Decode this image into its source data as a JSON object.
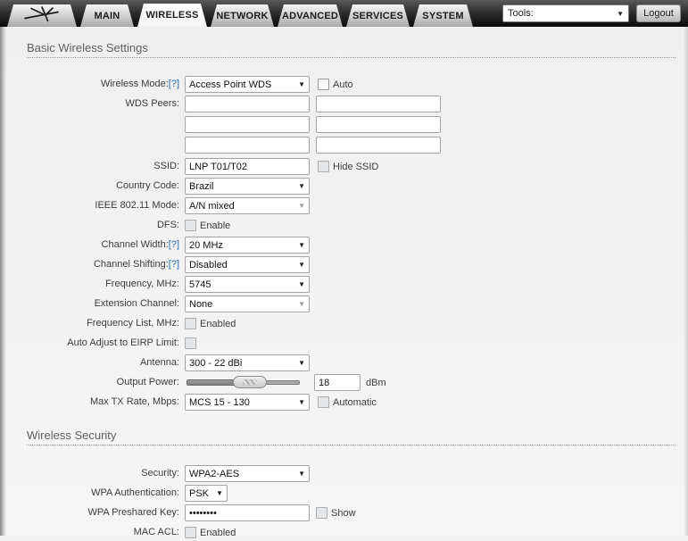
{
  "topbar": {
    "tabs": [
      "MAIN",
      "WIRELESS",
      "NETWORK",
      "ADVANCED",
      "SERVICES",
      "SYSTEM"
    ],
    "active_tab": "WIRELESS",
    "tools_label": "Tools:",
    "logout_label": "Logout",
    "select_arrow": "▼"
  },
  "basic_wireless": {
    "title": "Basic Wireless Settings",
    "wireless_mode": {
      "label": "Wireless Mode:",
      "help": "[?]",
      "value": "Access Point WDS",
      "auto_checkbox_label": "Auto"
    },
    "wds_peers": {
      "label": "WDS Peers:",
      "values": [
        "",
        "",
        "",
        "",
        "",
        ""
      ]
    },
    "ssid": {
      "label": "SSID:",
      "value": "LNP T01/T02",
      "hide_checkbox_label": "Hide SSID"
    },
    "country_code": {
      "label": "Country Code:",
      "value": "Brazil"
    },
    "ieee_mode": {
      "label": "IEEE 802.11 Mode:",
      "value": "A/N mixed"
    },
    "dfs": {
      "label": "DFS:",
      "checkbox_label": "Enable"
    },
    "channel_width": {
      "label": "Channel Width:",
      "help": "[?]",
      "value": "20 MHz"
    },
    "channel_shifting": {
      "label": "Channel Shifting:",
      "help": "[?]",
      "value": "Disabled"
    },
    "frequency": {
      "label": "Frequency, MHz:",
      "value": "5745"
    },
    "extension_channel": {
      "label": "Extension Channel:",
      "value": "None"
    },
    "frequency_list": {
      "label": "Frequency List, MHz:",
      "checkbox_label": "Enabled"
    },
    "eirp_limit": {
      "label": "Auto Adjust to EIRP Limit:"
    },
    "antenna": {
      "label": "Antenna:",
      "value": "300 - 22 dBi"
    },
    "output_power": {
      "label": "Output Power:",
      "value": "18",
      "unit": "dBm"
    },
    "max_tx_rate": {
      "label": "Max TX Rate, Mbps:",
      "value": "MCS 15 - 130",
      "auto_checkbox_label": "Automatic"
    }
  },
  "wireless_security": {
    "title": "Wireless Security",
    "security": {
      "label": "Security:",
      "value": "WPA2-AES"
    },
    "wpa_authentication": {
      "label": "WPA Authentication:",
      "value": "PSK"
    },
    "wpa_preshared_key": {
      "label": "WPA Preshared Key:",
      "value": "••••••••",
      "show_checkbox_label": "Show"
    },
    "mac_acl": {
      "label": "MAC ACL:",
      "checkbox_label": "Enabled"
    }
  }
}
